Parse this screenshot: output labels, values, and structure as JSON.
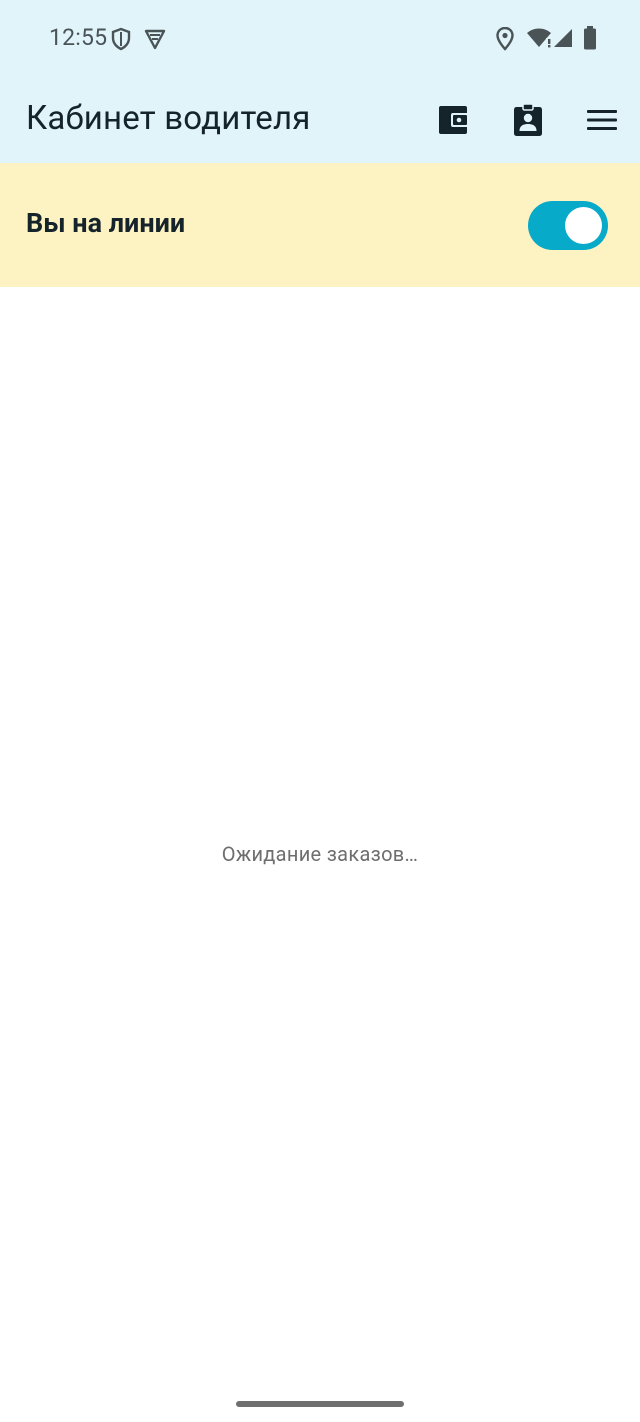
{
  "status_bar": {
    "time": "12:55",
    "icons": [
      "shield-icon",
      "vpn-icon",
      "location-icon",
      "wifi-icon",
      "cell-signal-icon",
      "battery-icon"
    ]
  },
  "app_bar": {
    "title": "Кабинет водителя",
    "actions": [
      "wallet-icon",
      "driver-card-icon",
      "menu-icon"
    ]
  },
  "online": {
    "label": "Вы на линии",
    "toggle_on": true,
    "toggle_color": "#07aac8"
  },
  "main": {
    "waiting_text": "Ожидание заказов…"
  },
  "colors": {
    "header_bg": "#e1f4fa",
    "online_bg": "#fdf2c1",
    "text_dark": "#15232b"
  }
}
